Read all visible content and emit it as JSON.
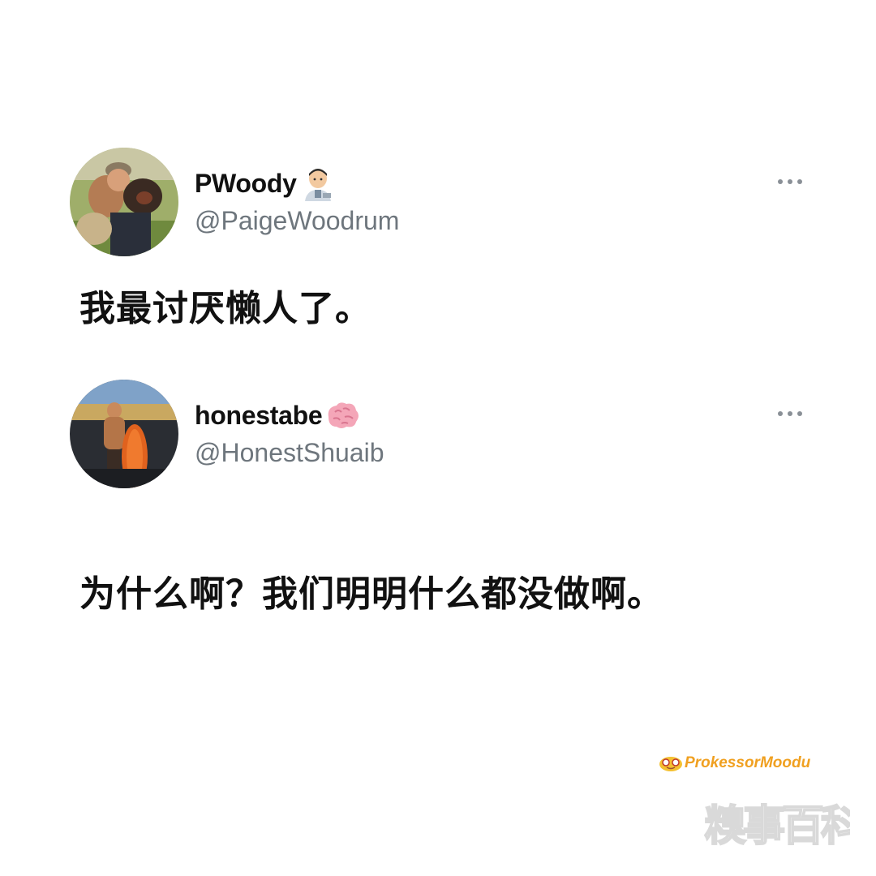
{
  "tweets": [
    {
      "display_name": "PWoody",
      "name_emoji": "man-technologist-emoji",
      "handle": "@PaigeWoodrum",
      "text": "我最讨厌懒人了。",
      "avatar": "person-with-dog-photo",
      "menu_icon": "more-options-icon"
    },
    {
      "display_name": "honestabe",
      "name_emoji": "brain-emoji",
      "handle": "@HonestShuaib",
      "text": "为什么啊？我们明明什么都没做啊。",
      "avatar": "man-with-surfboard-photo",
      "menu_icon": "more-options-icon"
    }
  ],
  "watermarks": {
    "brand": "ProkessorMoodu",
    "brand_icon": "glasses-face-icon",
    "site_logo": "糗事百科"
  },
  "colors": {
    "background": "#ffffff",
    "text": "#111111",
    "handle": "#6e767d",
    "brand_watermark": "#f0a020"
  }
}
